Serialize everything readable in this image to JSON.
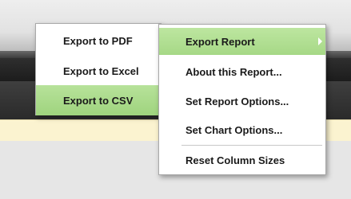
{
  "export_submenu": {
    "items": [
      {
        "label": "Export to PDF"
      },
      {
        "label": "Export to Excel"
      },
      {
        "label": "Export to CSV"
      }
    ],
    "active_item": "Export to CSV"
  },
  "context_menu": {
    "items": [
      {
        "label": "Export Report"
      },
      {
        "label": "About this Report..."
      },
      {
        "label": "Set Report Options..."
      },
      {
        "label": "Set Chart Options..."
      },
      {
        "label": "Reset Column Sizes"
      }
    ],
    "active_item": "Export Report"
  },
  "colors": {
    "highlight_green": "#a6d886",
    "info_bar_yellow": "#fbf3d0",
    "dark_toolbar": "#2a2a2a"
  }
}
